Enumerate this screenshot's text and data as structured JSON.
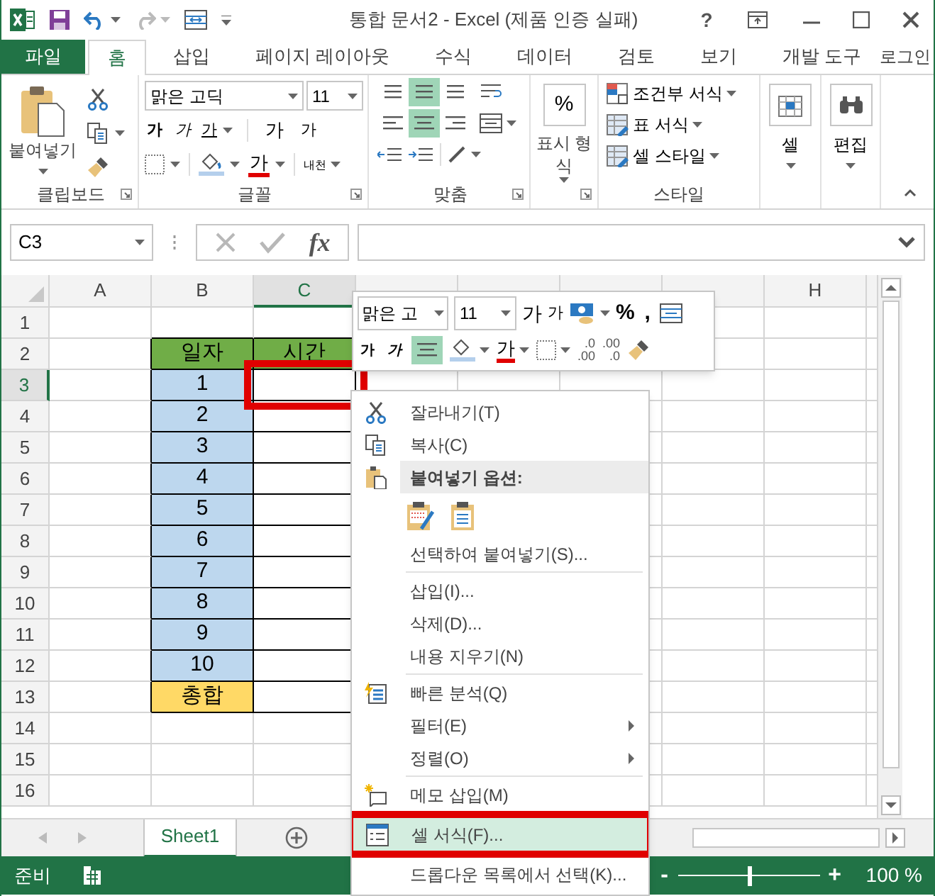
{
  "window": {
    "title": "통합 문서2 - Excel (제품 인증 실패)",
    "help": "?"
  },
  "tabs": [
    {
      "label": "파일",
      "kind": "file",
      "selected": false
    },
    {
      "label": "홈",
      "kind": "tab",
      "selected": true
    },
    {
      "label": "삽입",
      "kind": "tab",
      "selected": false
    },
    {
      "label": "페이지 레이아웃",
      "kind": "tab",
      "selected": false
    },
    {
      "label": "수식",
      "kind": "tab",
      "selected": false
    },
    {
      "label": "데이터",
      "kind": "tab",
      "selected": false
    },
    {
      "label": "검토",
      "kind": "tab",
      "selected": false
    },
    {
      "label": "보기",
      "kind": "tab",
      "selected": false
    },
    {
      "label": "개발 도구",
      "kind": "tab",
      "selected": false
    }
  ],
  "sign_in": "로그인",
  "ribbon": {
    "clipboard": {
      "paste": "붙여넣기",
      "label": "클립보드"
    },
    "font": {
      "name": "맑은 고딕",
      "size": "11",
      "bold": "가",
      "italic": "가",
      "underline": "가",
      "grow": "가",
      "shrink": "가",
      "color_button": "가",
      "phonetic": "내천",
      "label": "글꼴"
    },
    "alignment": {
      "label": "맞춤",
      "vertical": [
        {
          "selected": false
        },
        {
          "selected": true
        },
        {
          "selected": false
        }
      ],
      "horizontal": [
        {
          "selected": false
        },
        {
          "selected": true
        },
        {
          "selected": false
        }
      ]
    },
    "number": {
      "percent": "%",
      "format": "표시 형식"
    },
    "styles": {
      "items": [
        "조건부 서식",
        "표 서식",
        "셀 스타일"
      ],
      "label": "스타일"
    },
    "cells": {
      "label": "셀"
    },
    "editing": {
      "label": "편집"
    }
  },
  "name_box": "C3",
  "formula_fx": "fx",
  "columns": [
    {
      "label": "A",
      "selected": false
    },
    {
      "label": "B",
      "selected": false
    },
    {
      "label": "C",
      "selected": true
    },
    {
      "selected": false
    },
    {
      "selected": false
    },
    {
      "selected": false
    },
    {
      "selected": false
    },
    {
      "label": "H",
      "selected": false
    }
  ],
  "rows": [
    {
      "label": "1",
      "selected": false
    },
    {
      "label": "2",
      "selected": false,
      "b": {
        "text": "일자",
        "kind": "header"
      },
      "c": {
        "text": "시간",
        "kind": "header",
        "outlined": false
      }
    },
    {
      "label": "3",
      "selected": true,
      "b": {
        "text": "1",
        "kind": "index"
      },
      "c": {
        "kind": "data",
        "outlined": true
      }
    },
    {
      "label": "4",
      "selected": false,
      "b": {
        "text": "2",
        "kind": "index"
      },
      "c": {
        "kind": "data",
        "outlined": false
      }
    },
    {
      "label": "5",
      "selected": false,
      "b": {
        "text": "3",
        "kind": "index"
      },
      "c": {
        "kind": "data",
        "outlined": false
      }
    },
    {
      "label": "6",
      "selected": false,
      "b": {
        "text": "4",
        "kind": "index"
      },
      "c": {
        "kind": "data",
        "outlined": false
      }
    },
    {
      "label": "7",
      "selected": false,
      "b": {
        "text": "5",
        "kind": "index"
      },
      "c": {
        "kind": "data",
        "outlined": false
      }
    },
    {
      "label": "8",
      "selected": false,
      "b": {
        "text": "6",
        "kind": "index"
      },
      "c": {
        "kind": "data",
        "outlined": false
      }
    },
    {
      "label": "9",
      "selected": false,
      "b": {
        "text": "7",
        "kind": "index"
      },
      "c": {
        "kind": "data",
        "outlined": false
      }
    },
    {
      "label": "10",
      "selected": false,
      "b": {
        "text": "8",
        "kind": "index"
      },
      "c": {
        "kind": "data",
        "outlined": false
      }
    },
    {
      "label": "11",
      "selected": false,
      "b": {
        "text": "9",
        "kind": "index"
      },
      "c": {
        "kind": "data",
        "outlined": false
      }
    },
    {
      "label": "12",
      "selected": false,
      "b": {
        "text": "10",
        "kind": "index"
      },
      "c": {
        "kind": "data",
        "outlined": false
      }
    },
    {
      "label": "13",
      "selected": false,
      "b": {
        "text": "총합",
        "kind": "total"
      },
      "c": {
        "kind": "data",
        "outlined": false
      }
    },
    {
      "label": "14",
      "selected": false
    },
    {
      "label": "15",
      "selected": false
    },
    {
      "label": "16",
      "selected": false
    }
  ],
  "mini_toolbar": {
    "font_name": "맑은 고",
    "font_size": "11",
    "grow": "가",
    "shrink": "가",
    "percent": "%",
    "comma": ",",
    "bold": "가",
    "italic": "가",
    "center_selected": true,
    "font_color": "가",
    "decimals": [
      {
        "top": ".0",
        "bottom": ".00"
      },
      {
        "top": ".00",
        "bottom": ".0"
      }
    ]
  },
  "context_menu": [
    {
      "kind": "item",
      "label": "잘라내기(T)",
      "submenu": false,
      "selected": false,
      "outlined": false
    },
    {
      "kind": "item",
      "label": "복사(C)",
      "submenu": false,
      "selected": false,
      "outlined": false
    },
    {
      "kind": "header",
      "label": "붙여넣기 옵션:"
    },
    {
      "kind": "paste_icons"
    },
    {
      "kind": "item",
      "label": "선택하여 붙여넣기(S)...",
      "submenu": false,
      "selected": false,
      "outlined": false
    },
    {
      "kind": "separator"
    },
    {
      "kind": "item",
      "label": "삽입(I)...",
      "submenu": false,
      "selected": false,
      "outlined": false
    },
    {
      "kind": "item",
      "label": "삭제(D)...",
      "submenu": false,
      "selected": false,
      "outlined": false
    },
    {
      "kind": "item",
      "label": "내용 지우기(N)",
      "submenu": false,
      "selected": false,
      "outlined": false
    },
    {
      "kind": "separator"
    },
    {
      "kind": "item",
      "label": "빠른 분석(Q)",
      "submenu": false,
      "selected": false,
      "outlined": false
    },
    {
      "kind": "item",
      "label": "필터(E)",
      "submenu": true,
      "selected": false,
      "outlined": false
    },
    {
      "kind": "item",
      "label": "정렬(O)",
      "submenu": true,
      "selected": false,
      "outlined": false
    },
    {
      "kind": "separator"
    },
    {
      "kind": "item",
      "label": "메모 삽입(M)",
      "submenu": false,
      "selected": false,
      "outlined": false
    },
    {
      "kind": "item",
      "label": "셀 서식(F)...",
      "submenu": false,
      "selected": true,
      "outlined": true
    },
    {
      "kind": "item",
      "label": "드롭다운 목록에서 선택(K)...",
      "submenu": false,
      "selected": false,
      "outlined": false
    }
  ],
  "sheet_tabs": [
    {
      "label": "Sheet1",
      "selected": true
    }
  ],
  "status_bar": {
    "text": "준비",
    "zoom_minus": "-",
    "zoom_plus": "+",
    "zoom": "100 %",
    "zoom_slider": {
      "level": 0.5
    }
  }
}
